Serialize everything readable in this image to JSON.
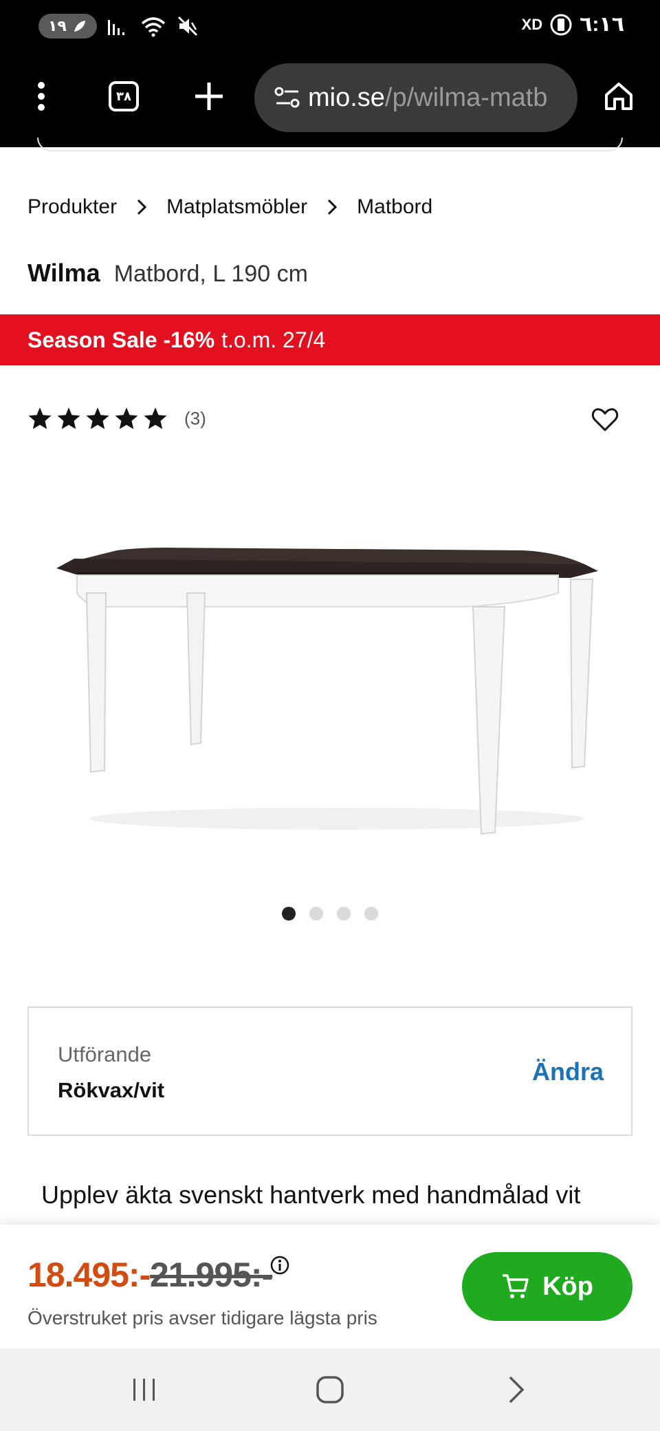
{
  "status_bar": {
    "notification_pill": "١٩",
    "carrier_icon": "XD",
    "time": "٦:١٦",
    "icons": [
      "signal-icon",
      "wifi-icon",
      "mute-icon",
      "battery-icon"
    ]
  },
  "browser": {
    "tab_count": "٣٨",
    "url_domain": "mio.se",
    "url_path": "/p/wilma-matb",
    "icons": [
      "menu-dots-icon",
      "tabs-icon",
      "plus-icon",
      "site-settings-icon",
      "home-icon"
    ]
  },
  "breadcrumb": {
    "items": [
      "Produkter",
      "Matplatsmöbler",
      "Matbord"
    ]
  },
  "product": {
    "brand": "Wilma",
    "description": "Matbord, L 190 cm",
    "rating_stars": 5,
    "review_count": "(3)"
  },
  "sale": {
    "label": "Season Sale -16%",
    "until": "t.o.m. 27/4",
    "color": "#e3111f"
  },
  "gallery": {
    "image_count": 4,
    "active_index": 0
  },
  "variant": {
    "label": "Utförande",
    "value": "Rökvax/vit",
    "change_label": "Ändra"
  },
  "description_text": "Upplev äkta svenskt hantverk med handmålad vit",
  "price": {
    "current": "18.495:-",
    "previous": "21.995:-",
    "note": "Överstruket pris avser tidigare lägsta pris",
    "current_color": "#d44b0f"
  },
  "buy_button": {
    "label": "Köp",
    "color": "#1faa1f"
  }
}
